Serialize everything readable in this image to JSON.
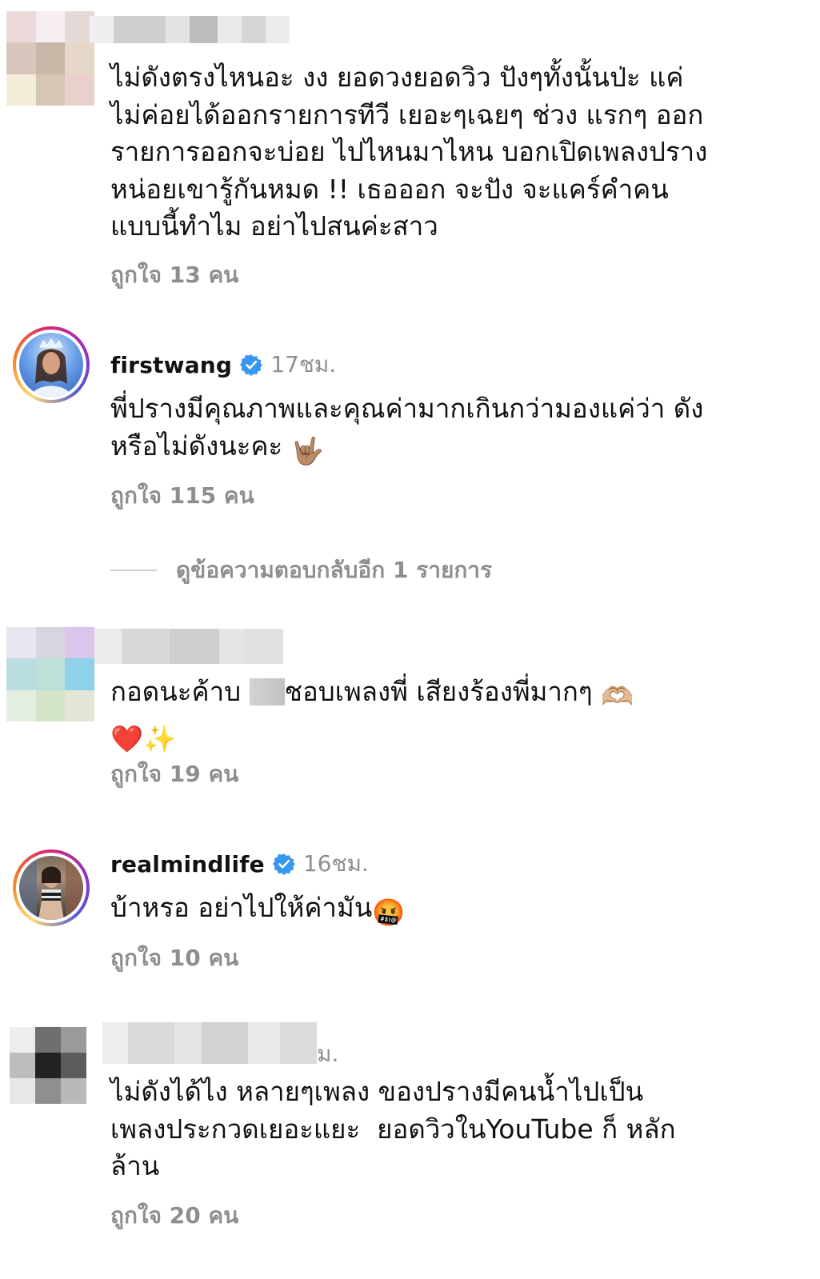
{
  "comments": [
    {
      "username": "",
      "time": "",
      "text": "ไม่ดังตรงไหนอะ งง ยอดวงยอดวิว ปังๆทั้งนั้นป่ะ แค่ ไม่ค่อยได้ออกรายการทีวี เยอะๆเฉยๆ ช่วง แรกๆ ออกรายการออกจะบ่อย ไปไหนมาไหน บอกเปิดเพลงปราง หน่อยเขารู้กันหมด !! เธอออก จะปัง จะแคร์คำคนแบบนี้ทำไม อย่าไปสนค่ะสาว",
      "likes": "ถูกใจ 13 คน",
      "avatar_blurred": true
    },
    {
      "username": "firstwang",
      "verified": true,
      "time": "17ชม.",
      "text": "พี่ปรางมีคุณภาพและคุณค่ามากเกินกว่ามองแค่ว่า ดังหรือไม่ดังนะคะ",
      "emoji": "🤟🏽",
      "likes": "ถูกใจ 115 คน",
      "replies_label": "ดูข้อความตอบกลับอีก 1 รายการ"
    },
    {
      "username": "",
      "time": "",
      "text_before": "กอดนะค้าบ ",
      "text_after": "ชอบเพลงพี่ เสียงร้องพี่มากๆ",
      "emoji": "🫶🏼",
      "emoji_line2": "❤️✨",
      "likes": "ถูกใจ 19 คน",
      "avatar_blurred": true
    },
    {
      "username": "realmindlife",
      "verified": true,
      "time": "16ชม.",
      "text": "บ้าหรอ อย่าไปให้ค่ามัน",
      "emoji": "🤬",
      "likes": "ถูกใจ 10 คน"
    },
    {
      "username": "",
      "time_suffix": "ม.",
      "text": "ไม่ดังได้ไง หลายๆเพลง ของปรางมีคนน้ำไปเป็น เพลงประกวดเยอะแยะ  ยอดวิวในYouTube ก็ หลักล้าน",
      "likes": "ถูกใจ 20 คน",
      "avatar_blurred": true
    }
  ],
  "colors": {
    "text": "#111111",
    "muted": "#8e8e8e",
    "verified": "#3897f0"
  },
  "icons": {
    "verified": "verified-badge-icon"
  }
}
